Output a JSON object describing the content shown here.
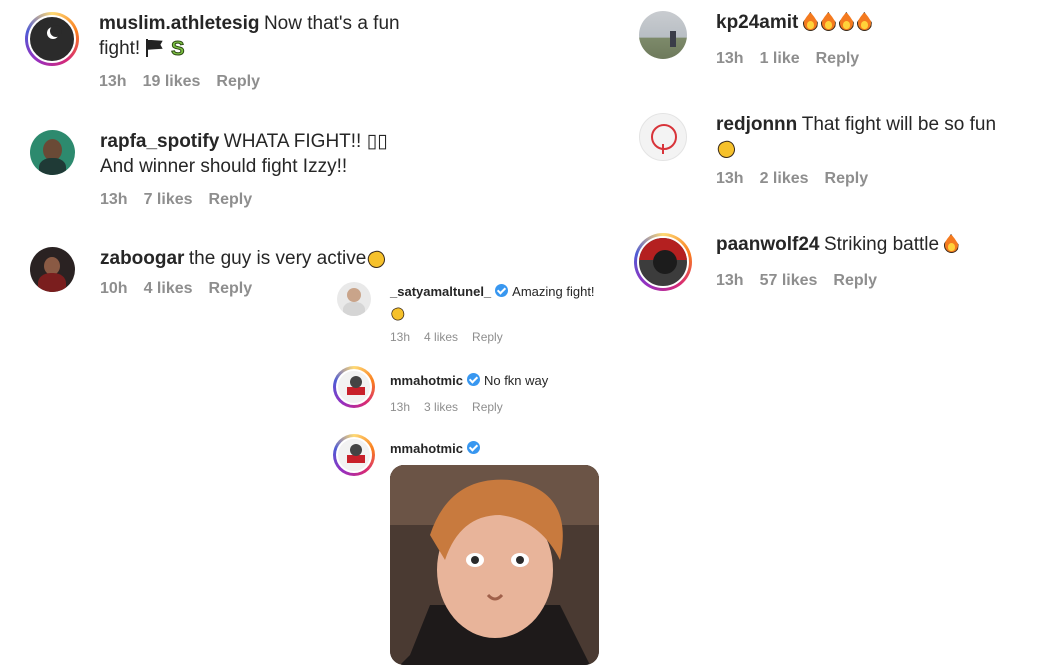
{
  "comments": [
    {
      "user": "muslim.athletesig",
      "text_line1": "Now that's a fun",
      "text_line2": "fight!",
      "emojis": [
        "pirate-flag",
        "snake"
      ],
      "time": "13h",
      "likes": "19 likes",
      "reply": "Reply"
    },
    {
      "user": "rapfa_spotify",
      "text_line1": "WHATA FIGHT!! ▯▯",
      "text_line2": "And winner should fight Izzy!!",
      "time": "13h",
      "likes": "7 likes",
      "reply": "Reply"
    },
    {
      "user": "zaboogar",
      "text": "the guy is very active",
      "emoji": "clapping-hands",
      "time": "10h",
      "likes": "4 likes",
      "reply": "Reply"
    },
    {
      "user": "kp24amit",
      "emojis": [
        "fire",
        "fire",
        "fire",
        "fire"
      ],
      "time": "13h",
      "likes": "1 like",
      "reply": "Reply"
    },
    {
      "user": "redjonnn",
      "text": "That fight will be so fun",
      "emoji": "clapping-hands",
      "time": "13h",
      "likes": "2 likes",
      "reply": "Reply"
    },
    {
      "user": "paanwolf24",
      "text": "Striking battle",
      "emoji": "fire",
      "time": "13h",
      "likes": "57 likes",
      "reply": "Reply"
    }
  ],
  "thread": [
    {
      "user": "_satyamaltunel_",
      "verified": true,
      "text": "Amazing fight!",
      "emoji": "clapping-hands",
      "time": "13h",
      "likes": "4 likes",
      "reply": "Reply"
    },
    {
      "user": "mmahotmic",
      "verified": true,
      "text": "No fkn way",
      "time": "13h",
      "likes": "3 likes",
      "reply": "Reply"
    },
    {
      "user": "mmahotmic",
      "verified": true,
      "attachment": "gif"
    }
  ],
  "colors": {
    "text": "#262626",
    "meta": "#8e8e8e",
    "verified": "#3897f0"
  }
}
